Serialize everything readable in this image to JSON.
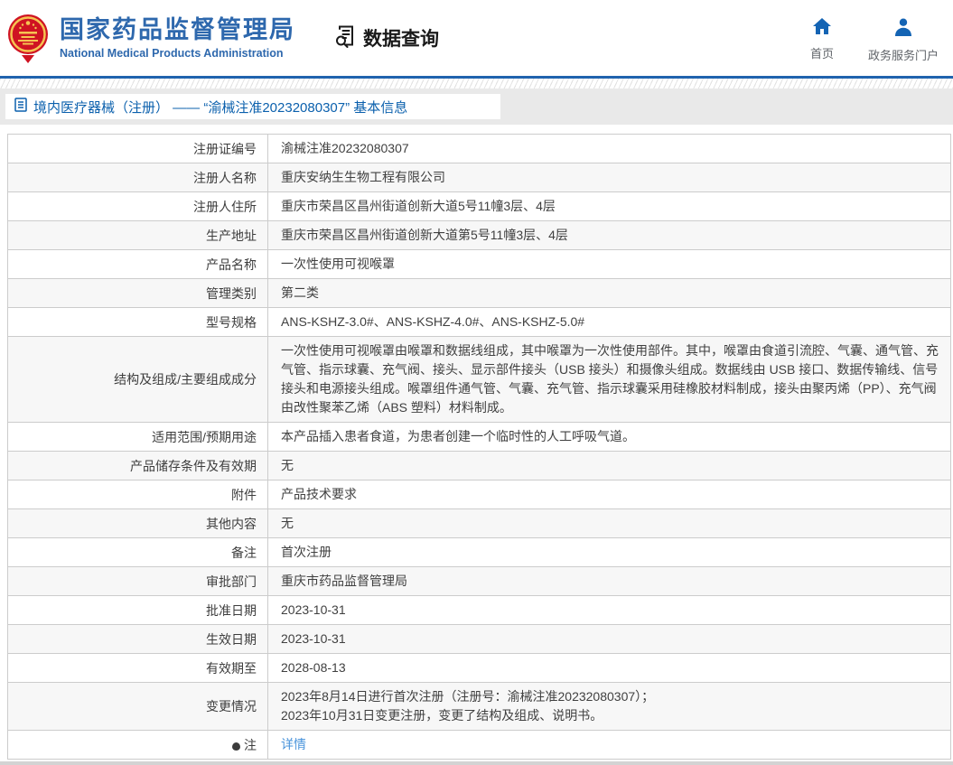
{
  "header": {
    "org_name_cn": "国家药品监督管理局",
    "org_name_en": "National Medical Products Administration",
    "data_query_label": "数据查询",
    "nav": [
      {
        "label": "首页",
        "icon": "home-icon"
      },
      {
        "label": "政务服务门户",
        "icon": "user-icon"
      }
    ]
  },
  "breadcrumb": {
    "icon": "document-list-icon",
    "text": "境内医疗器械（注册） —— “渝械注准20232080307” 基本信息"
  },
  "table": {
    "rows": [
      {
        "label": "注册证编号",
        "value": "渝械注准20232080307"
      },
      {
        "label": "注册人名称",
        "value": "重庆安纳生生物工程有限公司"
      },
      {
        "label": "注册人住所",
        "value": "重庆市荣昌区昌州街道创新大道5号11幢3层、4层"
      },
      {
        "label": "生产地址",
        "value": "重庆市荣昌区昌州街道创新大道第5号11幢3层、4层"
      },
      {
        "label": "产品名称",
        "value": "一次性使用可视喉罩"
      },
      {
        "label": "管理类别",
        "value": "第二类"
      },
      {
        "label": "型号规格",
        "value": "ANS-KSHZ-3.0#、ANS-KSHZ-4.0#、ANS-KSHZ-5.0#"
      },
      {
        "label": "结构及组成/主要组成成分",
        "value": "一次性使用可视喉罩由喉罩和数据线组成，其中喉罩为一次性使用部件。其中，喉罩由食道引流腔、气囊、通气管、充气管、指示球囊、充气阀、接头、显示部件接头（USB 接头）和摄像头组成。数据线由 USB 接口、数据传输线、信号接头和电源接头组成。喉罩组件通气管、气囊、充气管、指示球囊采用硅橡胶材料制成，接头由聚丙烯（PP）、充气阀由改性聚苯乙烯（ABS 塑料）材料制成。"
      },
      {
        "label": "适用范围/预期用途",
        "value": "本产品插入患者食道，为患者创建一个临时性的人工呼吸气道。"
      },
      {
        "label": "产品储存条件及有效期",
        "value": "无"
      },
      {
        "label": "附件",
        "value": "产品技术要求"
      },
      {
        "label": "其他内容",
        "value": "无"
      },
      {
        "label": "备注",
        "value": "首次注册"
      },
      {
        "label": "审批部门",
        "value": "重庆市药品监督管理局"
      },
      {
        "label": "批准日期",
        "value": "2023-10-31"
      },
      {
        "label": "生效日期",
        "value": "2023-10-31"
      },
      {
        "label": "有效期至",
        "value": "2028-08-13"
      },
      {
        "label": "变更情况",
        "value": "2023年8月14日进行首次注册（注册号：渝械注准20232080307）；\n2023年10月31日变更注册，变更了结构及组成、说明书。"
      },
      {
        "label": "注",
        "label_icon": "note-icon",
        "value": "详情",
        "link": true
      }
    ]
  },
  "colors": {
    "brand_blue": "#2e68ad",
    "header_line_blue": "#2063ae",
    "link_blue": "#4a94db",
    "breadcrumb_blue": "#0b60ad",
    "emblem_red": "#cf1322",
    "emblem_gold": "#f5c351",
    "zebra_gray": "#f7f7f7",
    "band_gray": "#e9e9e9",
    "border_gray": "#cccccc",
    "icon_blue": "#1464b4"
  }
}
